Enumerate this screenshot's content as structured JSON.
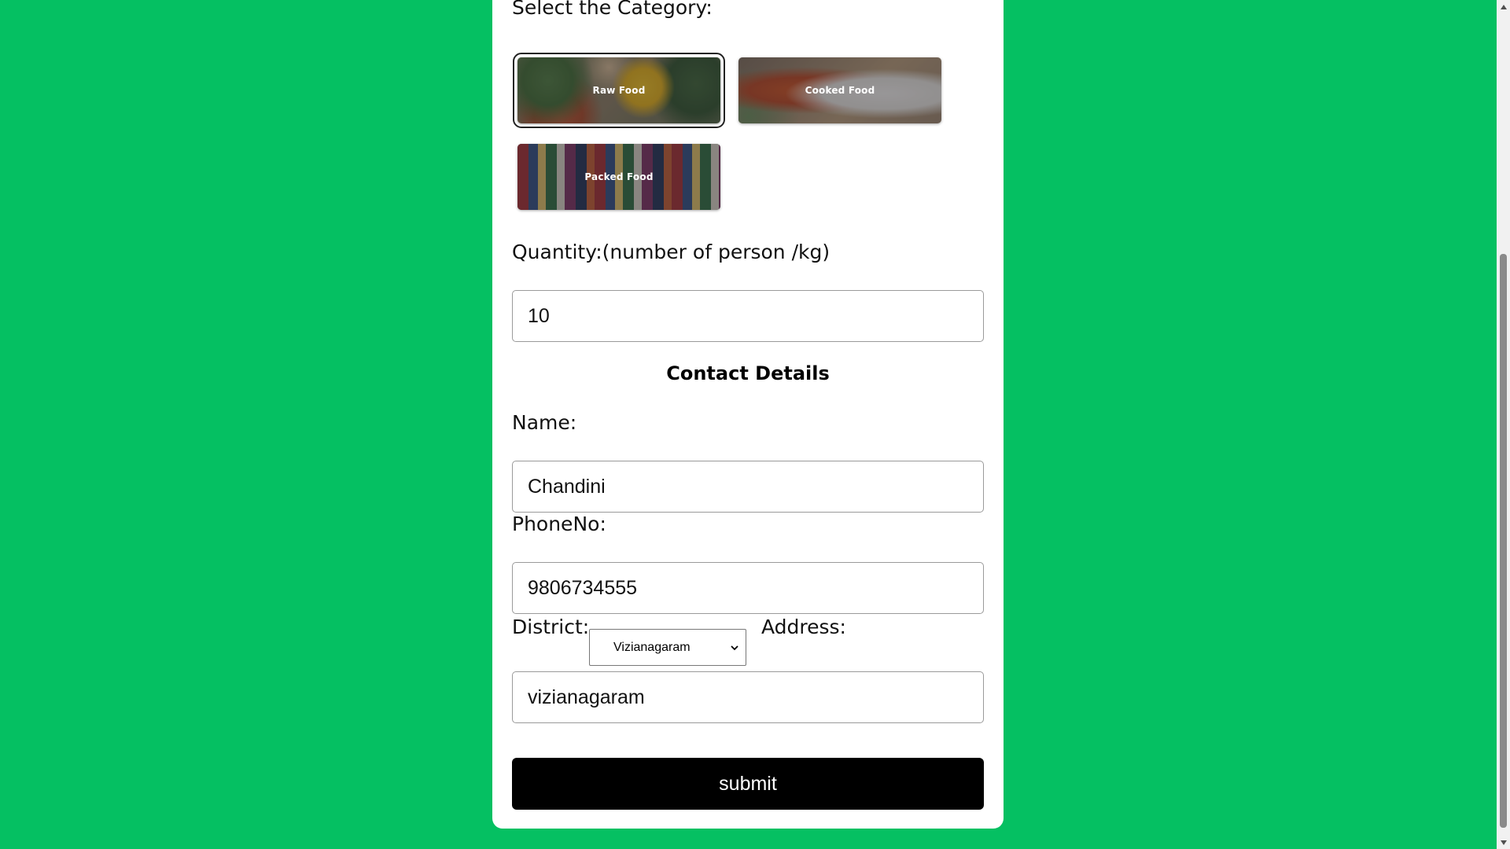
{
  "form": {
    "category_label": "Select the Category:",
    "categories": [
      {
        "label": "Raw Food",
        "selected": true
      },
      {
        "label": "Cooked Food",
        "selected": false
      },
      {
        "label": "Packed Food",
        "selected": false
      }
    ],
    "quantity_label": "Quantity:(number of person /kg)",
    "quantity_value": "10",
    "contact_title": "Contact Details",
    "name_label": "Name:",
    "name_value": "Chandini",
    "phone_label": "PhoneNo:",
    "phone_value": "9806734555",
    "district_label": "District:",
    "district_value": "Vizianagaram",
    "address_label": "Address:",
    "address_value": "vizianagaram",
    "submit_label": "submit"
  },
  "colors": {
    "background": "#05c062",
    "card": "#ffffff",
    "submit_bg": "#000000"
  }
}
